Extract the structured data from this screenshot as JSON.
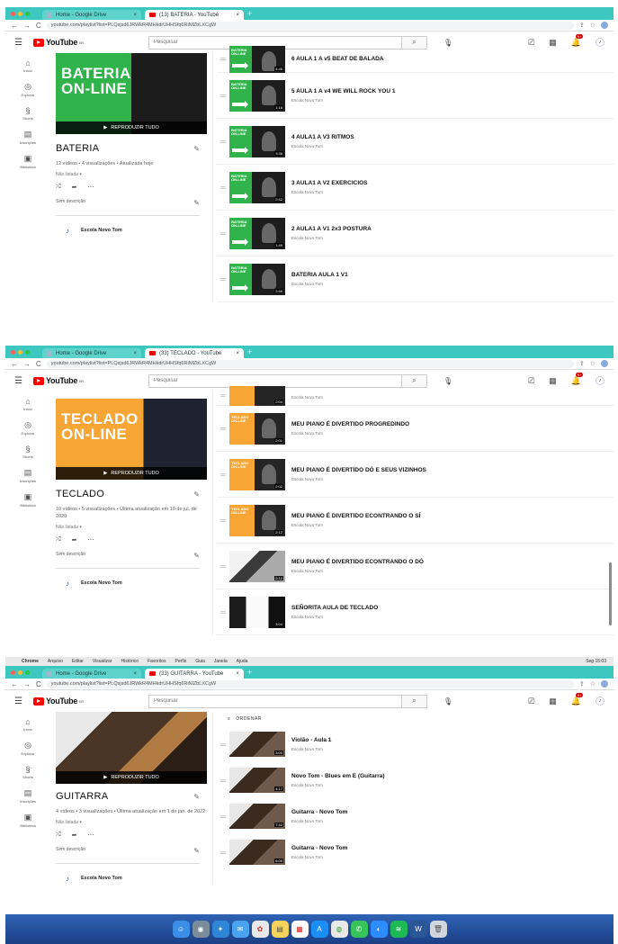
{
  "common": {
    "search_placeholder": "Pesquisar",
    "play_all": "REPRODUZIR TUDO",
    "privacy": "Não listada",
    "no_description": "Sem descrição",
    "owner": "Escola Novo Tom",
    "sort_label": "ORDENAR",
    "notif_count": "9+",
    "guide": [
      "Início",
      "Explorar",
      "Shorts",
      "Inscrições",
      "Biblioteca"
    ]
  },
  "shots": [
    {
      "tabs": [
        "Home - Google Drive",
        "(13) BATERIA - YouTube"
      ],
      "url": "youtube.com/playlist?list=PLQsjsd6JRWkR4MHkdrUHHSfq6RiNlZbLXCgW",
      "banner_text": "BATERIA\nON-LINE",
      "title": "BATERIA",
      "stats": "12 vídeos • 4 visualizações • Atualizada hoje",
      "videos": [
        {
          "title": "6 AULA 1 A v5 BEAT DE BALADA",
          "channel": "Escola Novo Tom",
          "duration": "4:46",
          "style": "green"
        },
        {
          "title": "5 AULA 1 A v4 WE WILL ROCK YOU 1",
          "channel": "Escola Novo Tom",
          "duration": "1:18",
          "style": "green"
        },
        {
          "title": "4 AULA1 A V3 RITMOS",
          "channel": "Escola Novo Tom",
          "duration": "3:36",
          "style": "green"
        },
        {
          "title": "3 AULA1 A V2 EXERCICIOS",
          "channel": "Escola Novo Tom",
          "duration": "2:42",
          "style": "green"
        },
        {
          "title": "2 AULA1 A V1 2x3 POSTURA",
          "channel": "Escola Novo Tom",
          "duration": "1:49",
          "style": "green"
        },
        {
          "title": "BATERIA AULA 1 V1",
          "channel": "Escola Novo Tom",
          "duration": "2:59",
          "style": "green"
        }
      ]
    },
    {
      "tabs": [
        "Home - Google Drive",
        "(33) TECLADO - YouTube"
      ],
      "url": "youtube.com/playlist?list=PLQsjsd6JRWkR4MHkdrUHHSfq6RiNlZbLXCgW",
      "banner_text": "TECLADO\nON-LINE",
      "title": "TECLADO",
      "stats": "10 vídeos • 5 visualizações • Última atualização em 10 de jul. de 2020",
      "videos": [
        {
          "title": "",
          "channel": "Escola Novo Tom",
          "duration": "2:04",
          "style": "orange"
        },
        {
          "title": "MEU PIANO É DIVERTIDO PROGREDINDO",
          "channel": "Escola Novo Tom",
          "duration": "2:01",
          "style": "orange"
        },
        {
          "title": "MEU PIANO É DIVERTIDO DÓ E SEUS VIZINHOS",
          "channel": "Escola Novo Tom",
          "duration": "2:02",
          "style": "orange"
        },
        {
          "title": "MEU PIANO É DIVERTIDO ECONTRANDO O SÍ",
          "channel": "Escola Novo Tom",
          "duration": "2:12",
          "style": "orange"
        },
        {
          "title": "MEU PIANO É DIVERTIDO ECONTRANDO O DÓ",
          "channel": "Escola Novo Tom",
          "duration": "2:12",
          "style": "photo"
        },
        {
          "title": "SEÑORITA AULA DE TECLADO",
          "channel": "Escola Novo Tom",
          "duration": "3:04",
          "style": "senorita"
        }
      ]
    },
    {
      "tabs": [
        "Home - Google Drive",
        "(33) GUITARRA - YouTube"
      ],
      "url": "youtube.com/playlist?list=PLQsjsd6JRWkR4MHkdrUHHSfq6RiNlZbLXCgW",
      "title": "GUITARRA",
      "stats": "4 vídeos • 3 visualizações • Última atualização em 1 de jan. de 2022",
      "videos": [
        {
          "title": "Violão - Aula 1",
          "channel": "Escola Novo Tom",
          "duration": "3:00",
          "style": "guitar"
        },
        {
          "title": "Novo Tom - Blues em E (Guitarra)",
          "channel": "Escola Novo Tom",
          "duration": "4:17",
          "style": "guitar"
        },
        {
          "title": "Guitarra - Novo Tom",
          "channel": "Escola Novo Tom",
          "duration": "7:42",
          "style": "guitar"
        },
        {
          "title": "Guitarra - Novo Tom",
          "channel": "Escola Novo Tom",
          "duration": "6:09",
          "style": "guitar"
        }
      ]
    }
  ],
  "menubar": {
    "items": [
      "Chrome",
      "Arquivo",
      "Editar",
      "Visualizar",
      "Histórico",
      "Favoritos",
      "Perfis",
      "Guia",
      "Janela",
      "Ajuda"
    ],
    "right": "Seg 15:03"
  },
  "dock": {
    "icons": [
      "finder-icon",
      "launchpad-icon",
      "safari-icon",
      "mail-icon",
      "photos-icon",
      "notes-icon",
      "calendar-icon",
      "app-store-icon",
      "chrome-icon",
      "messages-icon",
      "zoom-icon",
      "spotify-icon",
      "word-icon",
      "trash-icon"
    ]
  },
  "colors": {
    "tabbar": "#3cc7c0",
    "yt_red": "#ff0000",
    "bateria_green": "#2fb34a",
    "teclado_orange": "#f7a636"
  }
}
